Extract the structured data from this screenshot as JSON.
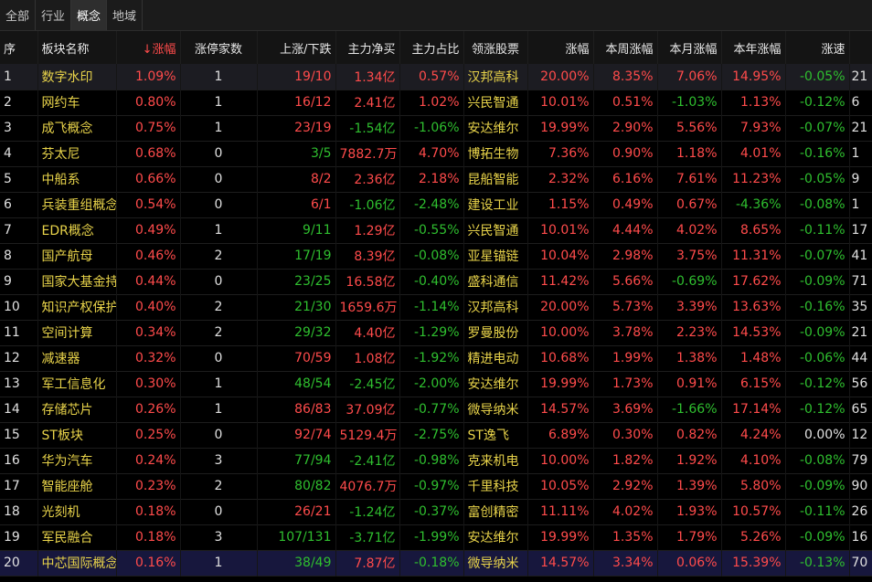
{
  "tabs": [
    "全部",
    "行业",
    "概念",
    "地域"
  ],
  "active_tab": 2,
  "columns": {
    "idx": "序",
    "name": "板块名称",
    "sort_arrow": "↓",
    "change": "涨幅",
    "limit_up": "涨停家数",
    "updown": "上涨/下跌",
    "netflow": "主力净买",
    "ratio": "主力占比",
    "leader": "领涨股票",
    "leader_change": "涨幅",
    "week": "本周涨幅",
    "month": "本月涨幅",
    "year": "本年涨幅",
    "speed": "涨速"
  },
  "colors": {
    "up": "#ff4b4b",
    "down": "#2fbf2f",
    "name": "#e8d34a",
    "bg": "#000000",
    "selected_row": "#17173d"
  },
  "rows": [
    {
      "idx": "1",
      "name": "数字水印",
      "change": "1.09%",
      "lim": "1",
      "up": "19",
      "dn": "10",
      "ud": "19/10",
      "net": "1.34亿",
      "ratio": "0.57%",
      "leader": "汉邦高科",
      "lchg": "20.00%",
      "week": "8.35%",
      "month": "7.06%",
      "year": "14.95%",
      "speed": "-0.05%",
      "over": "21"
    },
    {
      "idx": "2",
      "name": "网约车",
      "change": "0.80%",
      "lim": "1",
      "up": "16",
      "dn": "12",
      "ud": "16/12",
      "net": "2.41亿",
      "ratio": "1.02%",
      "leader": "兴民智通",
      "lchg": "10.01%",
      "week": "0.51%",
      "month": "-1.03%",
      "year": "1.13%",
      "speed": "-0.12%",
      "over": "6"
    },
    {
      "idx": "3",
      "name": "成飞概念",
      "change": "0.75%",
      "lim": "1",
      "up": "23",
      "dn": "19",
      "ud": "23/19",
      "net": "-1.54亿",
      "ratio": "-1.06%",
      "leader": "安达维尔",
      "lchg": "19.99%",
      "week": "2.90%",
      "month": "5.56%",
      "year": "7.93%",
      "speed": "-0.07%",
      "over": "21"
    },
    {
      "idx": "4",
      "name": "芬太尼",
      "change": "0.68%",
      "lim": "0",
      "up": "3",
      "dn": "5",
      "ud": "3/5",
      "net": "7882.7万",
      "ratio": "4.70%",
      "leader": "博拓生物",
      "lchg": "7.36%",
      "week": "0.90%",
      "month": "1.18%",
      "year": "4.01%",
      "speed": "-0.16%",
      "over": "1"
    },
    {
      "idx": "5",
      "name": "中船系",
      "change": "0.66%",
      "lim": "0",
      "up": "8",
      "dn": "2",
      "ud": "8/2",
      "net": "2.36亿",
      "ratio": "2.18%",
      "leader": "昆船智能",
      "lchg": "2.32%",
      "week": "6.16%",
      "month": "7.61%",
      "year": "11.23%",
      "speed": "-0.05%",
      "over": "9"
    },
    {
      "idx": "6",
      "name": "兵装重组概念",
      "change": "0.54%",
      "lim": "0",
      "up": "6",
      "dn": "1",
      "ud": "6/1",
      "net": "-1.06亿",
      "ratio": "-2.48%",
      "leader": "建设工业",
      "lchg": "1.15%",
      "week": "0.49%",
      "month": "0.67%",
      "year": "-4.36%",
      "speed": "-0.08%",
      "over": "1"
    },
    {
      "idx": "7",
      "name": "EDR概念",
      "change": "0.49%",
      "lim": "1",
      "up": "9",
      "dn": "11",
      "ud": "9/11",
      "net": "1.29亿",
      "ratio": "-0.55%",
      "leader": "兴民智通",
      "lchg": "10.01%",
      "week": "4.44%",
      "month": "4.02%",
      "year": "8.65%",
      "speed": "-0.11%",
      "over": "17"
    },
    {
      "idx": "8",
      "name": "国产航母",
      "change": "0.46%",
      "lim": "2",
      "up": "17",
      "dn": "19",
      "ud": "17/19",
      "net": "8.39亿",
      "ratio": "-0.08%",
      "leader": "亚星锚链",
      "lchg": "10.04%",
      "week": "2.98%",
      "month": "3.75%",
      "year": "11.31%",
      "speed": "-0.07%",
      "over": "41"
    },
    {
      "idx": "9",
      "name": "国家大基金持股",
      "change": "0.44%",
      "lim": "0",
      "up": "23",
      "dn": "25",
      "ud": "23/25",
      "net": "16.58亿",
      "ratio": "-0.40%",
      "leader": "盛科通信",
      "lchg": "11.42%",
      "week": "5.66%",
      "month": "-0.69%",
      "year": "17.62%",
      "speed": "-0.09%",
      "over": "71"
    },
    {
      "idx": "10",
      "name": "知识产权保护",
      "change": "0.40%",
      "lim": "2",
      "up": "21",
      "dn": "30",
      "ud": "21/30",
      "net": "1659.6万",
      "ratio": "-1.14%",
      "leader": "汉邦高科",
      "lchg": "20.00%",
      "week": "5.73%",
      "month": "3.39%",
      "year": "13.63%",
      "speed": "-0.16%",
      "over": "35"
    },
    {
      "idx": "11",
      "name": "空间计算",
      "change": "0.34%",
      "lim": "2",
      "up": "29",
      "dn": "32",
      "ud": "29/32",
      "net": "4.40亿",
      "ratio": "-1.29%",
      "leader": "罗曼股份",
      "lchg": "10.00%",
      "week": "3.78%",
      "month": "2.23%",
      "year": "14.53%",
      "speed": "-0.09%",
      "over": "21"
    },
    {
      "idx": "12",
      "name": "减速器",
      "change": "0.32%",
      "lim": "0",
      "up": "70",
      "dn": "59",
      "ud": "70/59",
      "net": "1.08亿",
      "ratio": "-1.92%",
      "leader": "精进电动",
      "lchg": "10.68%",
      "week": "1.99%",
      "month": "1.38%",
      "year": "1.48%",
      "speed": "-0.06%",
      "over": "44"
    },
    {
      "idx": "13",
      "name": "军工信息化",
      "change": "0.30%",
      "lim": "1",
      "up": "48",
      "dn": "54",
      "ud": "48/54",
      "net": "-2.45亿",
      "ratio": "-2.00%",
      "leader": "安达维尔",
      "lchg": "19.99%",
      "week": "1.73%",
      "month": "0.91%",
      "year": "6.15%",
      "speed": "-0.12%",
      "over": "56"
    },
    {
      "idx": "14",
      "name": "存储芯片",
      "change": "0.26%",
      "lim": "1",
      "up": "86",
      "dn": "83",
      "ud": "86/83",
      "net": "37.09亿",
      "ratio": "-0.77%",
      "leader": "微导纳米",
      "lchg": "14.57%",
      "week": "3.69%",
      "month": "-1.66%",
      "year": "17.14%",
      "speed": "-0.12%",
      "over": "65"
    },
    {
      "idx": "15",
      "name": "ST板块",
      "change": "0.25%",
      "lim": "0",
      "up": "92",
      "dn": "74",
      "ud": "92/74",
      "net": "5129.4万",
      "ratio": "-2.75%",
      "leader": "ST逸飞",
      "lchg": "6.89%",
      "week": "0.30%",
      "month": "0.82%",
      "year": "4.24%",
      "speed": "0.00%",
      "over": "12"
    },
    {
      "idx": "16",
      "name": "华为汽车",
      "change": "0.24%",
      "lim": "3",
      "up": "77",
      "dn": "94",
      "ud": "77/94",
      "net": "-2.41亿",
      "ratio": "-0.98%",
      "leader": "克来机电",
      "lchg": "10.00%",
      "week": "1.82%",
      "month": "1.92%",
      "year": "4.10%",
      "speed": "-0.08%",
      "over": "79"
    },
    {
      "idx": "17",
      "name": "智能座舱",
      "change": "0.23%",
      "lim": "2",
      "up": "80",
      "dn": "82",
      "ud": "80/82",
      "net": "4076.7万",
      "ratio": "-0.97%",
      "leader": "千里科技",
      "lchg": "10.05%",
      "week": "2.92%",
      "month": "1.39%",
      "year": "5.80%",
      "speed": "-0.09%",
      "over": "90"
    },
    {
      "idx": "18",
      "name": "光刻机",
      "change": "0.18%",
      "lim": "0",
      "up": "26",
      "dn": "21",
      "ud": "26/21",
      "net": "-1.24亿",
      "ratio": "-0.37%",
      "leader": "富创精密",
      "lchg": "11.11%",
      "week": "4.02%",
      "month": "1.93%",
      "year": "10.57%",
      "speed": "-0.11%",
      "over": "26"
    },
    {
      "idx": "19",
      "name": "军民融合",
      "change": "0.18%",
      "lim": "3",
      "up": "107",
      "dn": "131",
      "ud": "107/131",
      "net": "-3.71亿",
      "ratio": "-1.99%",
      "leader": "安达维尔",
      "lchg": "19.99%",
      "week": "1.35%",
      "month": "1.79%",
      "year": "5.26%",
      "speed": "-0.09%",
      "over": "16"
    },
    {
      "idx": "20",
      "name": "中芯国际概念",
      "change": "0.16%",
      "lim": "1",
      "up": "38",
      "dn": "49",
      "ud": "38/49",
      "net": "7.87亿",
      "ratio": "-0.18%",
      "leader": "微导纳米",
      "lchg": "14.57%",
      "week": "3.34%",
      "month": "0.06%",
      "year": "15.39%",
      "speed": "-0.13%",
      "over": "70"
    }
  ]
}
